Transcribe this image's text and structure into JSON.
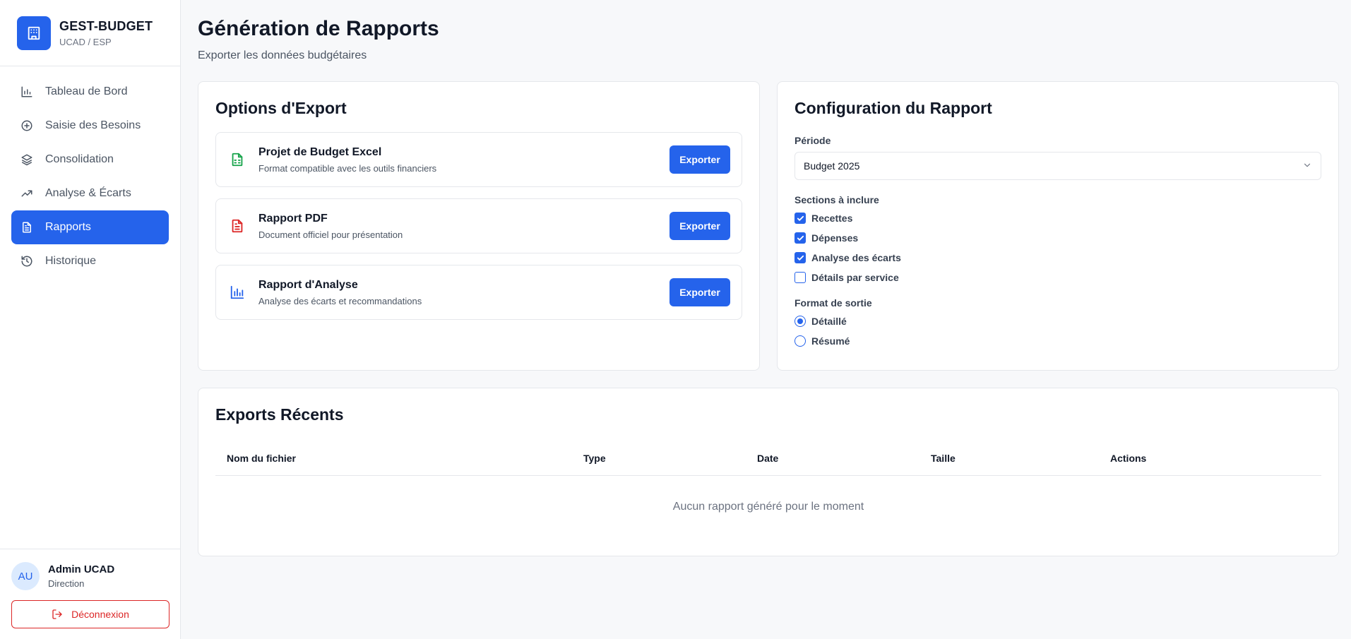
{
  "app": {
    "name": "GEST-BUDGET",
    "subtitle": "UCAD / ESP",
    "logo_icon": "building-icon"
  },
  "colors": {
    "accent": "#2563eb",
    "danger": "#dc2626",
    "excel": "#16a34a",
    "pdf": "#dc2626"
  },
  "sidebar": {
    "items": [
      {
        "label": "Tableau de Bord",
        "icon": "bar-chart-icon",
        "active": false
      },
      {
        "label": "Saisie des Besoins",
        "icon": "plus-circle-icon",
        "active": false
      },
      {
        "label": "Consolidation",
        "icon": "layers-icon",
        "active": false
      },
      {
        "label": "Analyse & Écarts",
        "icon": "trending-up-icon",
        "active": false
      },
      {
        "label": "Rapports",
        "icon": "file-text-icon",
        "active": true
      },
      {
        "label": "Historique",
        "icon": "history-icon",
        "active": false
      }
    ]
  },
  "user": {
    "initials": "AU",
    "name": "Admin UCAD",
    "role": "Direction",
    "logout_label": "Déconnexion"
  },
  "page": {
    "title": "Génération de Rapports",
    "subtitle": "Exporter les données budgétaires"
  },
  "export": {
    "title": "Options d'Export",
    "options": [
      {
        "title": "Projet de Budget Excel",
        "description": "Format compatible avec les outils financiers",
        "button": "Exporter",
        "icon": "spreadsheet-icon"
      },
      {
        "title": "Rapport PDF",
        "description": "Document officiel pour présentation",
        "button": "Exporter",
        "icon": "pdf-file-icon"
      },
      {
        "title": "Rapport d'Analyse",
        "description": "Analyse des écarts et recommandations",
        "button": "Exporter",
        "icon": "bar-chart-icon"
      }
    ]
  },
  "config": {
    "title": "Configuration du Rapport",
    "period_label": "Période",
    "period_value": "Budget 2025",
    "sections_label": "Sections à inclure",
    "sections": [
      {
        "label": "Recettes",
        "checked": true
      },
      {
        "label": "Dépenses",
        "checked": true
      },
      {
        "label": "Analyse des écarts",
        "checked": true
      },
      {
        "label": "Détails par service",
        "checked": false
      }
    ],
    "format_label": "Format de sortie",
    "formats": [
      {
        "label": "Détaillé",
        "selected": true
      },
      {
        "label": "Résumé",
        "selected": false
      }
    ]
  },
  "recent": {
    "title": "Exports Récents",
    "columns": [
      "Nom du fichier",
      "Type",
      "Date",
      "Taille",
      "Actions"
    ],
    "empty_message": "Aucun rapport généré pour le moment"
  }
}
